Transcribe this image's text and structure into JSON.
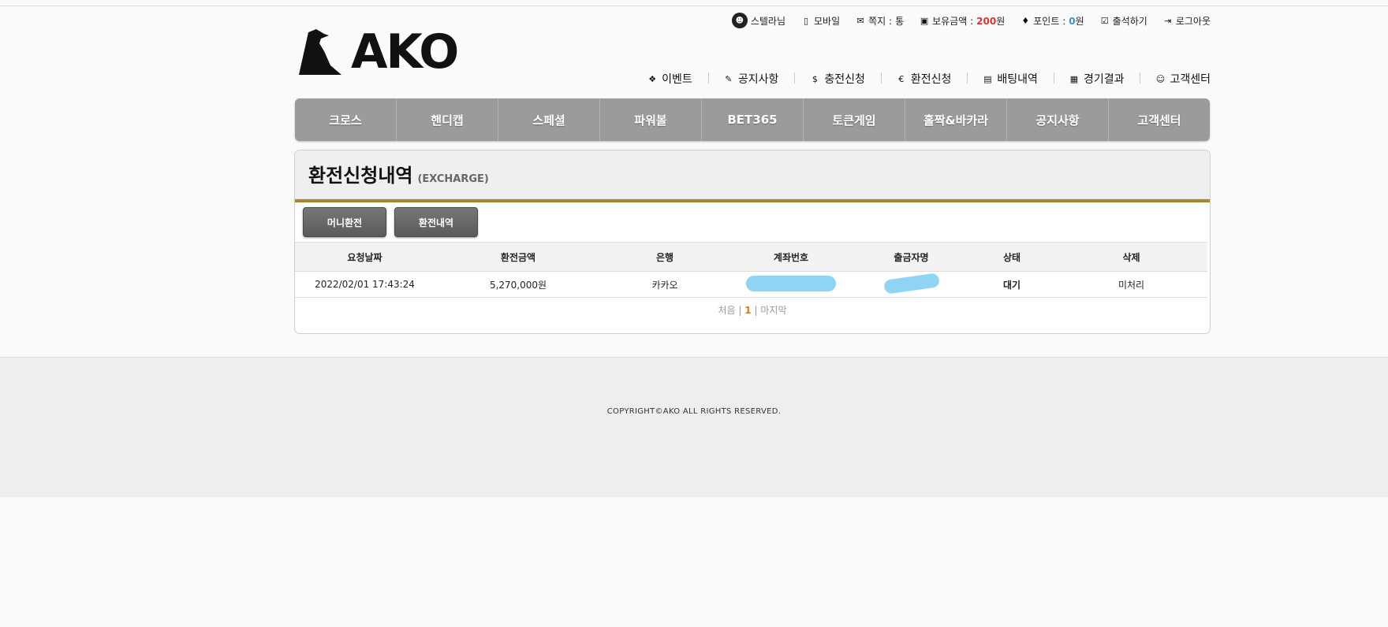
{
  "logo": {
    "text": "AKO"
  },
  "userbar": {
    "username": "스텔라님",
    "mobile": "모바일",
    "message_label": "쪽지 :",
    "message_count": "통",
    "balance_label": "보유금액 :",
    "balance_value": "200",
    "balance_unit": "원",
    "points_label": "포인트 :",
    "points_value": "0",
    "points_unit": "원",
    "attendance": "출석하기",
    "logout": "로그아웃"
  },
  "subnav": {
    "items": [
      {
        "label": "이벤트",
        "icon": "gift-icon"
      },
      {
        "label": "공지사항",
        "icon": "edit-icon"
      },
      {
        "label": "충전신청",
        "icon": "dollar-file-icon"
      },
      {
        "label": "환전신청",
        "icon": "euro-icon"
      },
      {
        "label": "배팅내역",
        "icon": "file-icon"
      },
      {
        "label": "경기결과",
        "icon": "clipboard-icon"
      },
      {
        "label": "고객센터",
        "icon": "smile-icon"
      }
    ]
  },
  "mainnav": {
    "items": [
      "크로스",
      "핸디캡",
      "스페셜",
      "파워볼",
      "BET365",
      "토큰게임",
      "홀짝&바카라",
      "공지사항",
      "고객센터"
    ]
  },
  "panel": {
    "title": "환전신청내역",
    "subtitle": "(EXCHARGE)",
    "buttons": [
      "머니환전",
      "환전내역"
    ]
  },
  "table": {
    "headers": [
      "요청날짜",
      "환전금액",
      "은행",
      "계좌번호",
      "출금자명",
      "상태",
      "삭제"
    ],
    "rows": [
      {
        "date": "2022/02/01 17:43:24",
        "amount": "5,270,000원",
        "bank": "카카오",
        "status": "대기",
        "delete": "미처리"
      }
    ]
  },
  "pager": {
    "first": "처음",
    "sep": "|",
    "current": "1",
    "last": "마지막"
  },
  "footer": {
    "copyright": "COPYRIGHT©AKO ALL RIGHTS RESERVED."
  },
  "colors": {
    "accent_gold": "#a8862a",
    "balance_red": "#dd3333",
    "points_blue": "#3a8fd8",
    "page_current": "#e07a00",
    "redaction": "#8fd3f5"
  }
}
